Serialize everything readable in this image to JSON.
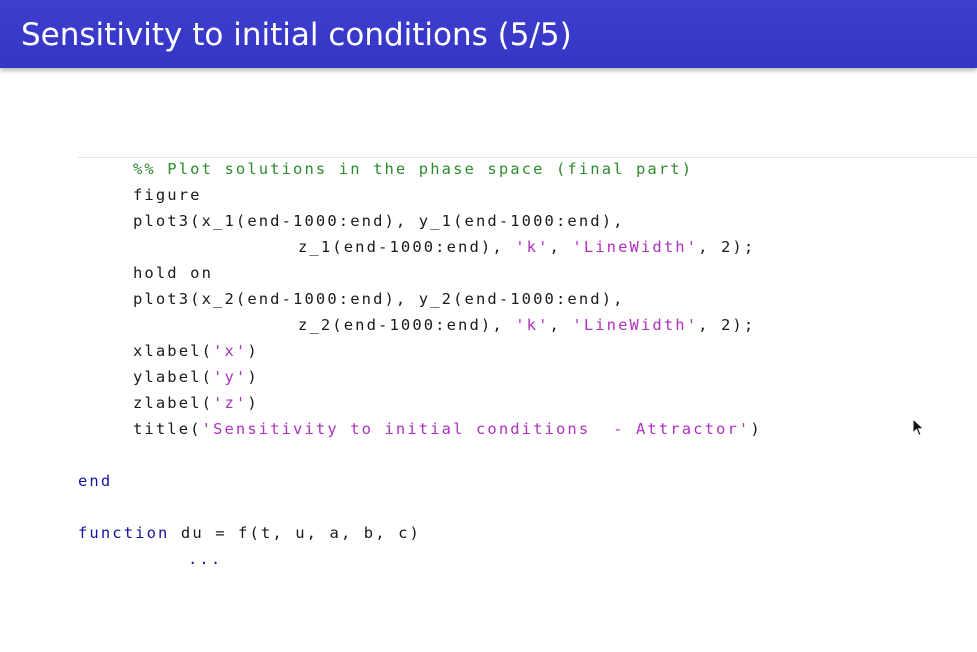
{
  "slide": {
    "title": "Sensitivity to initial conditions (5/5)"
  },
  "colors": {
    "title_bar": "#3838c8",
    "comment": "#2e8b2e",
    "keyword": "#1414a0",
    "string": "#b030c0",
    "code_text": "#1a1a1a"
  },
  "code": {
    "line1": {
      "comment": "%% Plot solutions in the phase space (final part)"
    },
    "line2": {
      "text": "figure"
    },
    "line3": {
      "pre": "plot3(x_1(end-1000:end), y_1(end-1000:end),"
    },
    "line4": {
      "pre": "z_1(end-1000:end), ",
      "s1": "'k'",
      "mid": ", ",
      "s2": "'LineWidth'",
      "post": ", 2);"
    },
    "line5": {
      "text": "hold on"
    },
    "line6": {
      "pre": "plot3(x_2(end-1000:end), y_2(end-1000:end),"
    },
    "line7": {
      "pre": "z_2(end-1000:end), ",
      "s1": "'k'",
      "mid": ", ",
      "s2": "'LineWidth'",
      "post": ", 2);"
    },
    "line8": {
      "pre": "xlabel(",
      "str": "'x'",
      "post": ")"
    },
    "line9": {
      "pre": "ylabel(",
      "str": "'y'",
      "post": ")"
    },
    "line10": {
      "pre": "zlabel(",
      "str": "'z'",
      "post": ")"
    },
    "line11": {
      "pre": "title(",
      "str": "'Sensitivity to initial conditions  - Attractor'",
      "post": ")"
    },
    "line12": {
      "kw": "end"
    },
    "line13": {
      "kw": "function",
      "post": " du = f(t, u, a, b, c)"
    },
    "line14": {
      "dots": "..."
    }
  }
}
